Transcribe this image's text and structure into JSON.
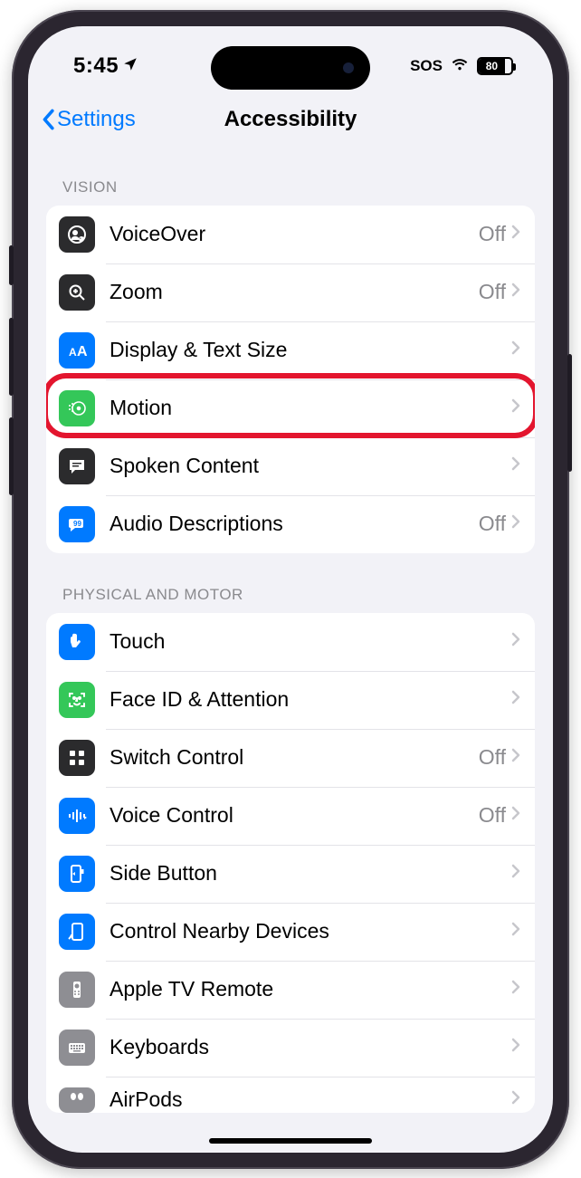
{
  "status": {
    "time": "5:45",
    "sos": "SOS",
    "battery_pct": "80"
  },
  "nav": {
    "back": "Settings",
    "title": "Accessibility"
  },
  "sections": {
    "vision": {
      "header": "VISION",
      "voiceover": {
        "label": "VoiceOver",
        "value": "Off"
      },
      "zoom": {
        "label": "Zoom",
        "value": "Off"
      },
      "display": {
        "label": "Display & Text Size"
      },
      "motion": {
        "label": "Motion"
      },
      "spoken": {
        "label": "Spoken Content"
      },
      "audiodesc": {
        "label": "Audio Descriptions",
        "value": "Off"
      }
    },
    "physical": {
      "header": "PHYSICAL AND MOTOR",
      "touch": {
        "label": "Touch"
      },
      "faceid": {
        "label": "Face ID & Attention"
      },
      "switch": {
        "label": "Switch Control",
        "value": "Off"
      },
      "voice": {
        "label": "Voice Control",
        "value": "Off"
      },
      "side": {
        "label": "Side Button"
      },
      "nearby": {
        "label": "Control Nearby Devices"
      },
      "appletv": {
        "label": "Apple TV Remote"
      },
      "keyboards": {
        "label": "Keyboards"
      },
      "airpods": {
        "label": "AirPods"
      }
    }
  },
  "highlighted_row": "motion"
}
